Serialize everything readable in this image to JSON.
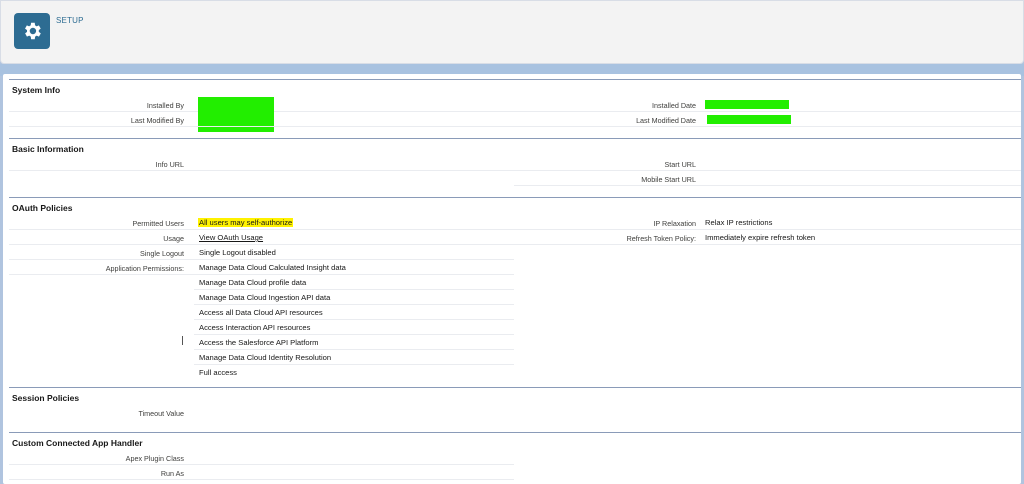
{
  "header": {
    "title": "SETUP",
    "icon": "gear-icon"
  },
  "system_info": {
    "title": "System Info",
    "installed_by_label": "Installed By",
    "last_modified_by_label": "Last Modified By",
    "installed_date_label": "Installed Date",
    "last_modified_date_label": "Last Modified Date"
  },
  "basic_info": {
    "title": "Basic Information",
    "info_url_label": "Info URL",
    "start_url_label": "Start URL",
    "mobile_start_url_label": "Mobile Start URL"
  },
  "oauth": {
    "title": "OAuth Policies",
    "permitted_users_label": "Permitted Users",
    "permitted_users_value": "All users may self-authorize",
    "usage_label": "Usage",
    "usage_link": "View OAuth Usage",
    "single_logout_label": "Single Logout",
    "single_logout_value": "Single Logout disabled",
    "app_permissions_label": "Application Permissions:",
    "permissions": [
      "Manage Data Cloud Calculated Insight data",
      "Manage Data Cloud profile data",
      "Manage Data Cloud Ingestion API data",
      "Access all Data Cloud API resources",
      "Access Interaction API resources",
      "Access the Salesforce API Platform",
      "Manage Data Cloud Identity Resolution",
      "Full access"
    ],
    "ip_relaxation_label": "IP Relaxation",
    "ip_relaxation_value": "Relax IP restrictions",
    "refresh_token_label": "Refresh Token Policy:",
    "refresh_token_value": "Immediately expire refresh token"
  },
  "session": {
    "title": "Session Policies",
    "timeout_label": "Timeout Value"
  },
  "handler": {
    "title": "Custom Connected App Handler",
    "apex_label": "Apex Plugin Class",
    "run_as_label": "Run As"
  },
  "colors": {
    "accent": "#2d6c92",
    "redaction": "#22ee00",
    "highlight": "#fff200"
  }
}
